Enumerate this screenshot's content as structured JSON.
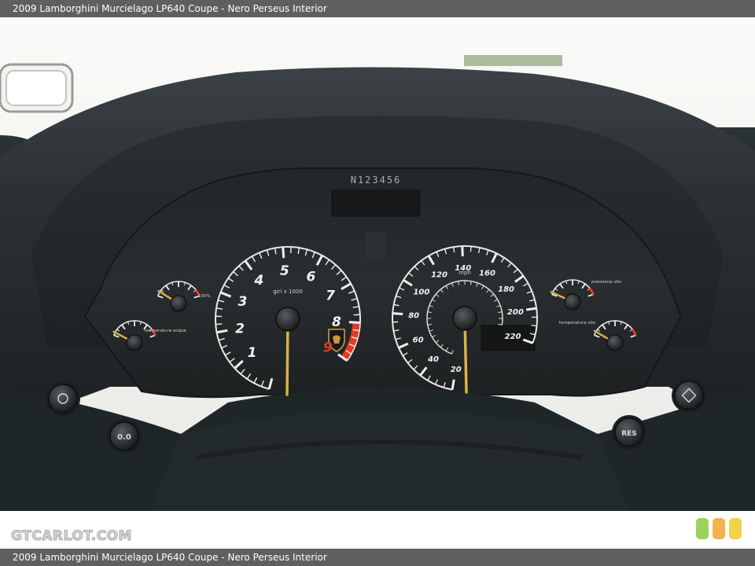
{
  "page": {
    "title": "2009 Lamborghini Murcielago LP640 Coupe - Nero Perseus Interior",
    "watermark": "GTCARLOT.COM"
  },
  "photo": {
    "odometer_serial": "N123456",
    "tachometer": {
      "labels": [
        "1",
        "2",
        "3",
        "4",
        "5",
        "6",
        "7",
        "8",
        "9"
      ],
      "unit": "giri x 1000",
      "redline_color": "#e23a24"
    },
    "speedometer": {
      "labels": [
        "20",
        "40",
        "60",
        "80",
        "100",
        "120",
        "140",
        "160",
        "180",
        "200",
        "220"
      ],
      "unit": "mph"
    },
    "gauge_labels": {
      "fuel": "100%",
      "temperature": "temperatura acqua",
      "oil_pressure": "pressione olio",
      "oil_temperature": "temperatura olio"
    },
    "needle_color": "#d9b24a"
  },
  "colors": {
    "title_bar": "#5f5f5f",
    "badge_green": "#9bd35a",
    "badge_orange": "#f4b14d",
    "badge_yellow": "#f1d34a"
  }
}
